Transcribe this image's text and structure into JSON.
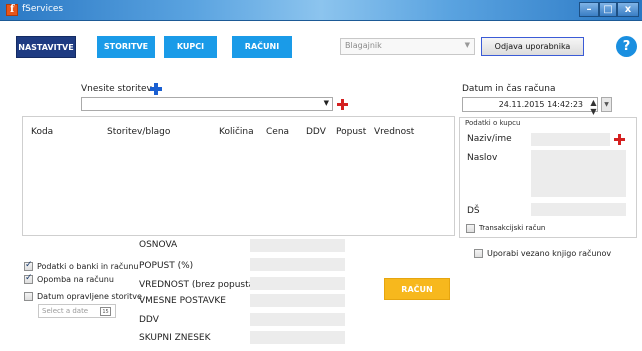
{
  "window": {
    "title": "fServices",
    "min": "–",
    "max": "□",
    "close": "x"
  },
  "nav": {
    "items": [
      "NASTAVITVE",
      "STORITVE",
      "KUPCI",
      "RAČUNI"
    ]
  },
  "blagajnik": {
    "placeholder": "Blagajnik",
    "arrow": "▼"
  },
  "logout": {
    "label": "Odjava uporabnika"
  },
  "help": {
    "label": "?"
  },
  "service": {
    "label": "Vnesite storitev",
    "arrow": "▼"
  },
  "table": {
    "columns": [
      "Koda",
      "Storitev/blago",
      "Količina",
      "Cena",
      "DDV",
      "Popust",
      "Vrednost"
    ]
  },
  "datetime": {
    "label": "Datum in čas računa",
    "value": "24.11.2015 14:42:23",
    "spin": "▲▼",
    "dd": "▼"
  },
  "customer": {
    "title": "Podatki o kupcu",
    "name_label": "Naziv/ime",
    "address_label": "Naslov",
    "tax_label": "DŠ",
    "transactional": "Transakcijski račun"
  },
  "bound_book": "Uporabi vezano knjigo računov",
  "options": {
    "bank": "Podatki o banki in računu",
    "note": "Opomba na računu",
    "service_date": "Datum opravljene storitve",
    "date_placeholder": "Select a date",
    "cal": "15"
  },
  "summary": {
    "labels": [
      "OSNOVA",
      "POPUST (%)",
      "VREDNOST (brez popusta)",
      "VMESNE POSTAVKE",
      "DDV",
      "SKUPNI ZNESEK"
    ]
  },
  "invoice_button": "RAČUN"
}
